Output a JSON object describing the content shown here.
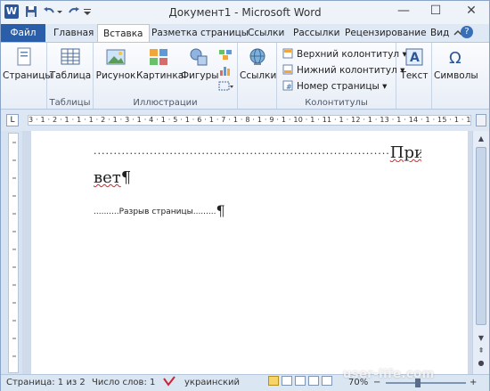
{
  "title_bar": {
    "app_icon": "W",
    "document_title": "Документ1 - Microsoft Word",
    "minimize": "—",
    "maximize": "☐",
    "close": "✕"
  },
  "tabs": [
    {
      "label": "Файл"
    },
    {
      "label": "Главная"
    },
    {
      "label": "Вставка"
    },
    {
      "label": "Разметка страницы"
    },
    {
      "label": "Ссылки"
    },
    {
      "label": "Рассылки"
    },
    {
      "label": "Рецензирование"
    },
    {
      "label": "Вид"
    }
  ],
  "active_tab": "Вставка",
  "ribbon": {
    "pages": {
      "button": "Страницы"
    },
    "tables": {
      "button": "Таблица",
      "group": "Таблицы"
    },
    "illustrations": {
      "picture": "Рисунок",
      "clipart": "Картинка",
      "shapes": "Фигуры",
      "group": "Иллюстрации"
    },
    "links": {
      "button": "Ссылки"
    },
    "header_footer": {
      "header": "Верхний колонтитул",
      "footer": "Нижний колонтитул",
      "page_number": "Номер страницы",
      "group": "Колонтитулы"
    },
    "text": {
      "button": "Текст"
    },
    "symbols": {
      "button": "Символы"
    }
  },
  "ruler": {
    "selector": "L",
    "scale": "3 · 1 · 2 · 1 · 1 · 1 · 2 · 1 · 3 · 1 · 4 · 1 · 5 · 1 · 6 · 1 · 7 · 1 · 8 · 1 · 9 · 1 · 10 · 1 · 11 · 1 · 12 · 1 · 13 · 1 · 14 · 1 · 15 · 1 · 16 · 1 · 17 · 1"
  },
  "document": {
    "line1_dots": "..........................................................................",
    "line1_word": "При-",
    "line2_word": "вет",
    "pilcrow": "¶",
    "page_break_left": "..........",
    "page_break_label": "Разрыв страницы",
    "page_break_right": "........."
  },
  "status": {
    "page": "Страница: 1 из 2",
    "words": "Число слов: 1",
    "language": "украинский",
    "zoom": "70%",
    "zoom_minus": "−",
    "zoom_plus": "+"
  },
  "watermark": "user-life.com"
}
